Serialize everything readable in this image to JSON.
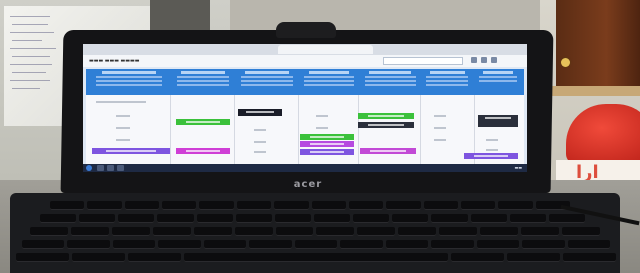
{
  "scene": {
    "type": "photo-of-laptop-screen"
  },
  "laptop": {
    "brand": "acer"
  }
}
